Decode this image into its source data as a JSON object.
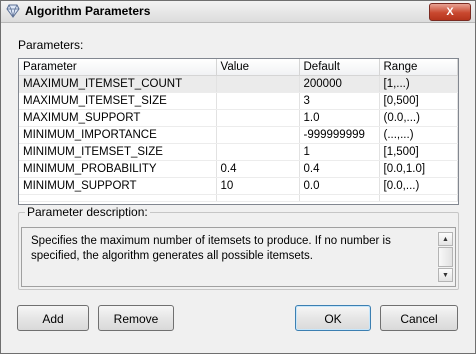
{
  "window": {
    "title": "Algorithm Parameters",
    "close_glyph": "X"
  },
  "parameters": {
    "label": "Parameters:",
    "columns": [
      "Parameter",
      "Value",
      "Default",
      "Range"
    ],
    "rows": [
      {
        "parameter": "MAXIMUM_ITEMSET_COUNT",
        "value": "",
        "default": "200000",
        "range": "[1,...)"
      },
      {
        "parameter": "MAXIMUM_ITEMSET_SIZE",
        "value": "",
        "default": "3",
        "range": "[0,500]"
      },
      {
        "parameter": "MAXIMUM_SUPPORT",
        "value": "",
        "default": "1.0",
        "range": "(0.0,...)"
      },
      {
        "parameter": "MINIMUM_IMPORTANCE",
        "value": "",
        "default": "-999999999",
        "range": "(...,...)"
      },
      {
        "parameter": "MINIMUM_ITEMSET_SIZE",
        "value": "",
        "default": "1",
        "range": "[1,500]"
      },
      {
        "parameter": "MINIMUM_PROBABILITY",
        "value": "0.4",
        "default": "0.4",
        "range": "[0.0,1.0]"
      },
      {
        "parameter": "MINIMUM_SUPPORT",
        "value": "10",
        "default": "0.0",
        "range": "[0.0,...)"
      }
    ],
    "selected_row": 0
  },
  "description": {
    "label": "Parameter description:",
    "text": "Specifies the maximum number of itemsets to produce. If no number is specified, the algorithm generates all possible itemsets."
  },
  "buttons": {
    "add": "Add",
    "remove": "Remove",
    "ok": "OK",
    "cancel": "Cancel"
  }
}
